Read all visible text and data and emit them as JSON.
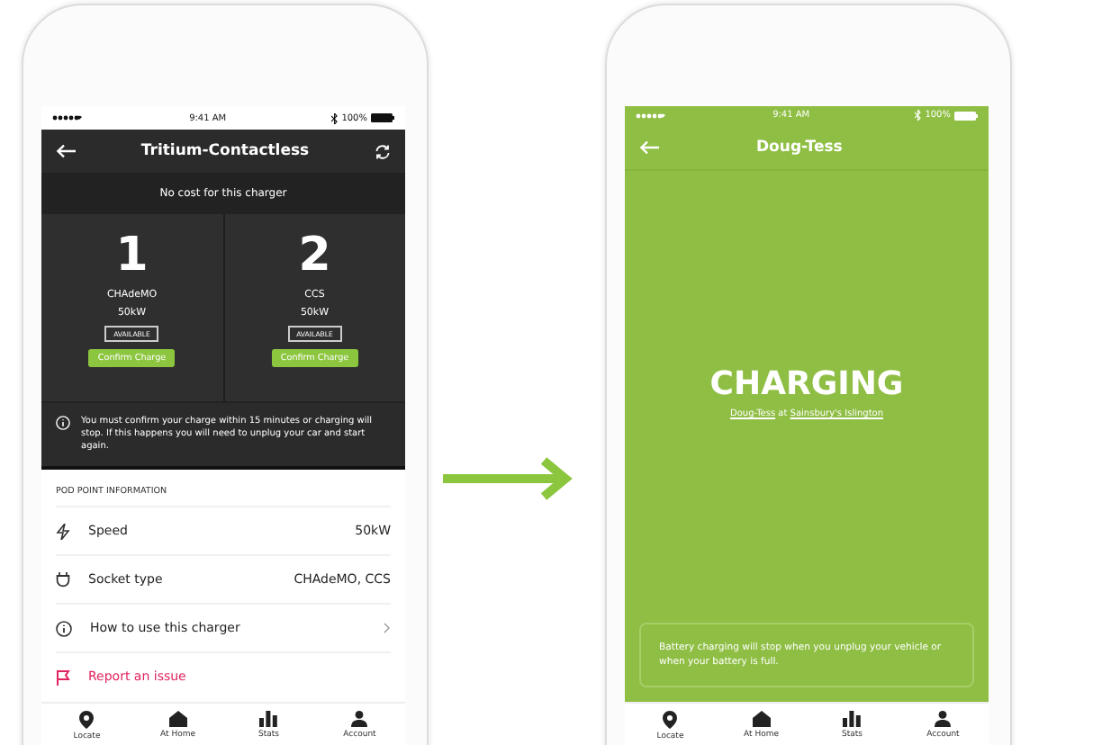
{
  "charger_phone": {
    "status_bar": {
      "time": "9:41 AM",
      "battery": "100%"
    },
    "title": "Tritium-Contactless",
    "cost_banner": "No cost for this charger",
    "connectors": [
      {
        "number": "1",
        "type": "CHAdeMO",
        "power": "50kW",
        "status": "AVAILABLE",
        "button": "Confirm Charge"
      },
      {
        "number": "2",
        "type": "CCS",
        "power": "50kW",
        "status": "AVAILABLE",
        "button": "Confirm Charge"
      }
    ],
    "notice": "You must confirm your charge within 15 minutes or charging will stop. If this happens you will need to unplug your car and start again.",
    "info_heading": "POD POINT INFORMATION",
    "info_rows": [
      {
        "kind": "detail",
        "label": "Speed",
        "value": "50kW"
      },
      {
        "kind": "detail",
        "label": "Socket type",
        "value": "CHAdeMO, CCS"
      },
      {
        "kind": "nav",
        "label": "How to use this charger"
      },
      {
        "kind": "alert",
        "label": "Report an issue"
      }
    ],
    "tabs": [
      "Locate",
      "At Home",
      "Stats",
      "Account"
    ]
  },
  "charging_phone": {
    "status_bar": {
      "time": "9:41 AM",
      "battery": "100%"
    },
    "title": "Doug-Tess",
    "status": "CHARGING",
    "charger_link": "Doug-Tess",
    "joiner": "at",
    "location_link": "Sainsbury's Islington",
    "notice": "Battery charging will stop when you unplug your vehicle or when your battery is full.",
    "tabs": [
      "Locate",
      "At Home",
      "Stats",
      "Account"
    ]
  }
}
